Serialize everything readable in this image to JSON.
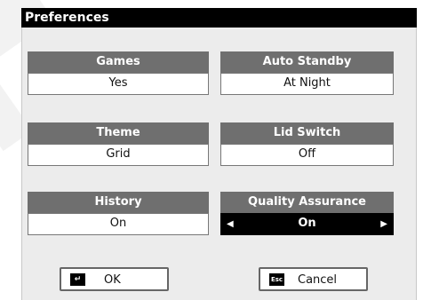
{
  "window": {
    "title": "Preferences"
  },
  "settings": [
    {
      "label": "Games",
      "value": "Yes"
    },
    {
      "label": "Auto Standby",
      "value": "At Night"
    },
    {
      "label": "Theme",
      "value": "Grid"
    },
    {
      "label": "Lid Switch",
      "value": "Off"
    },
    {
      "label": "History",
      "value": "On"
    },
    {
      "label": "Quality Assurance",
      "value": "On"
    }
  ],
  "buttons": {
    "ok": {
      "label": "OK",
      "key_icon": "enter-key-icon",
      "key_glyph": "↵"
    },
    "cancel": {
      "label": "Cancel",
      "key_icon": "esc-key-icon",
      "key_glyph": "Esc"
    }
  },
  "selector": {
    "left_glyph": "◀",
    "right_glyph": "▶"
  },
  "colors": {
    "titlebar": "#000000",
    "panel": "#ececec",
    "setting_label": "#6f6f6f",
    "selected_value": "#000000"
  }
}
